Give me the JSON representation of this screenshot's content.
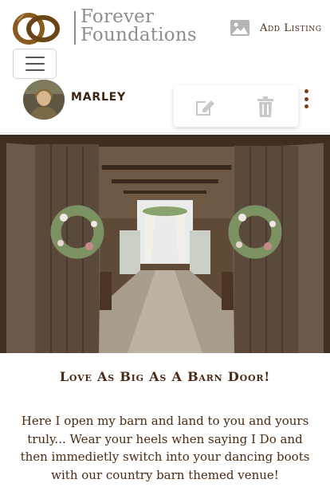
{
  "brand": {
    "line1": "Forever",
    "line2": "Foundations"
  },
  "nav": {
    "add_listing_label": "Add Listing",
    "add_listing_icon": "image-icon",
    "menu_icon": "hamburger-menu-icon"
  },
  "author": {
    "name": "MARLEY",
    "avatar_icon": "avatar"
  },
  "actions": {
    "edit_icon": "edit-icon",
    "delete_icon": "trash-icon",
    "more_icon": "kebab-menu-icon"
  },
  "post": {
    "image_subject": "barn-doors-with-floral-wreaths",
    "title": "Love As Big As A Barn Door!",
    "body": "Here I open my barn and land to you and yours truly... Wear your heels when saying I Do and then immedietly switch into your dancing boots with our country barn themed venue!"
  },
  "colors": {
    "accent": "#4a2a14",
    "kebab": "#7b3a10",
    "logo_gold": "#8a5a1e",
    "logo_gray": "#8e8e8e"
  }
}
